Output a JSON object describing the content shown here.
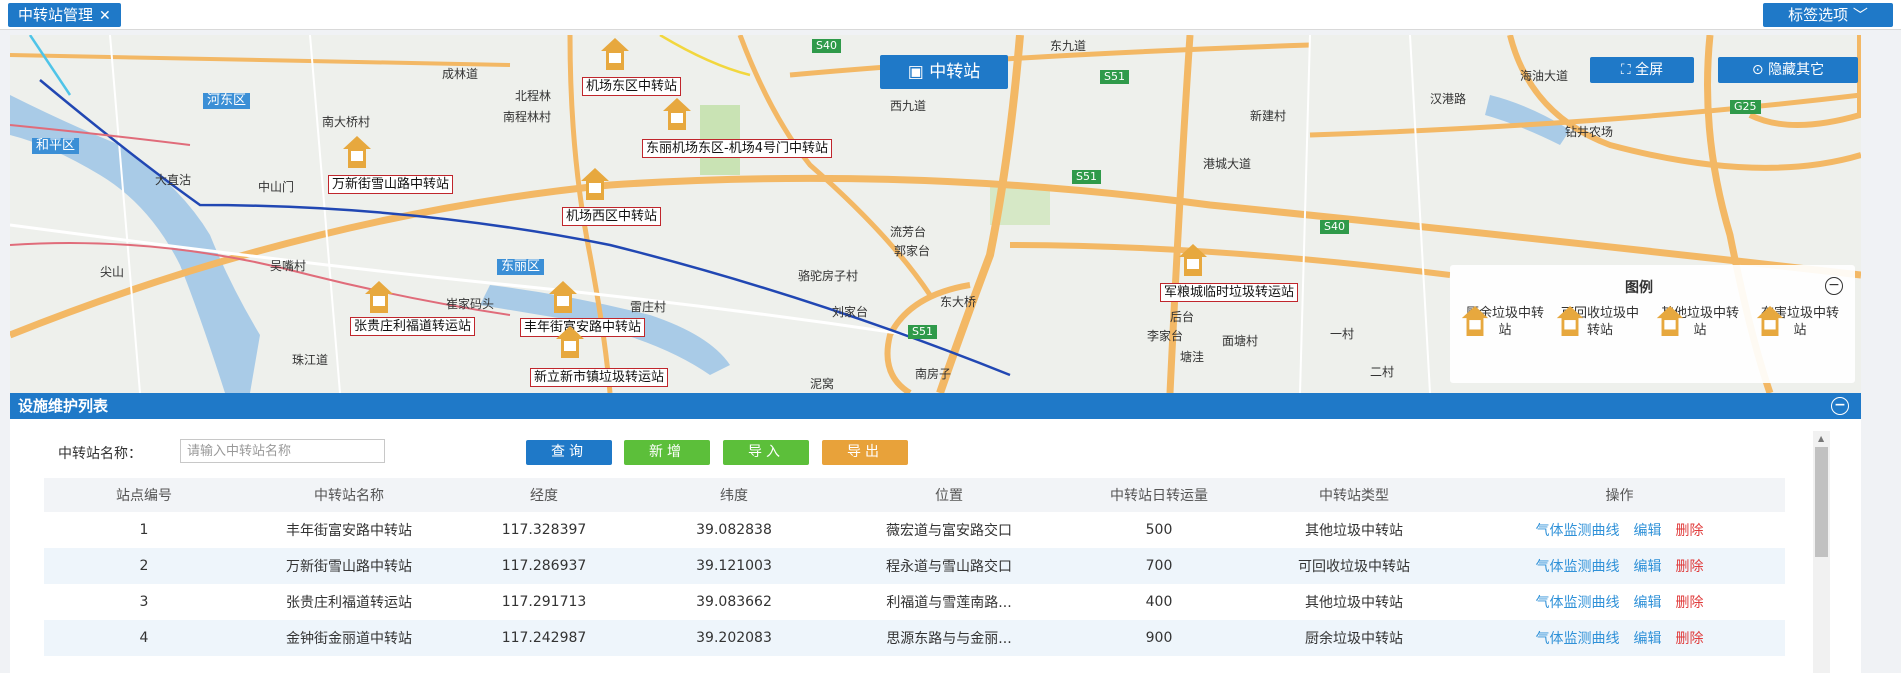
{
  "topbar": {
    "tab_label": "中转站管理",
    "tab_close": "✕",
    "tag_options": "标签选项",
    "tag_options_arrow": "﹀"
  },
  "map": {
    "title": "中转站",
    "fullscreen": "全屏",
    "hide_others": "隐藏其它",
    "districts": [
      "河东区",
      "和平区",
      "东丽区"
    ],
    "road_tags": [
      "S40",
      "S51",
      "S51",
      "S40",
      "S51",
      "G25"
    ],
    "place_labels": [
      "成林道",
      "北程林",
      "南程林村",
      "南大桥村",
      "大直沽",
      "中山门",
      "新建村",
      "港城大道",
      "钻井农场",
      "汉港路",
      "流芳台",
      "郭家台",
      "骆驼房子村",
      "吴嘴村",
      "东大桥",
      "刘家台",
      "后台",
      "李家台",
      "塘洼",
      "面塘村",
      "一村",
      "二村",
      "泥窝",
      "南房子",
      "尖山",
      "海油大道",
      "东九道",
      "西九道",
      "雷庄村",
      "崔家码头",
      "珠江道"
    ],
    "stations": [
      {
        "name": "机场东区中转站"
      },
      {
        "name": "东丽机场东区-机场4号门中转站"
      },
      {
        "name": "万新街雪山路中转站"
      },
      {
        "name": "机场西区中转站"
      },
      {
        "name": "军粮城临时垃圾转运站"
      },
      {
        "name": "张贵庄利福道转运站"
      },
      {
        "name": "丰年街富安路中转站"
      },
      {
        "name": "新立新市镇垃圾转运站"
      }
    ],
    "legend": {
      "title": "图例",
      "toggle": "−",
      "items": [
        "厨余垃圾中转站",
        "可回收垃圾中转站",
        "其他垃圾中转站",
        "有害垃圾中转站"
      ]
    }
  },
  "panel": {
    "title": "设施维护列表",
    "toggle": "−",
    "search_label": "中转站名称：",
    "search_placeholder": "请输入中转站名称",
    "buttons": {
      "query": "查询",
      "add": "新增",
      "import": "导入",
      "export": "导出"
    },
    "columns": [
      "站点编号",
      "中转站名称",
      "经度",
      "纬度",
      "位置",
      "中转站日转运量",
      "中转站类型",
      "操作"
    ],
    "row_actions": {
      "curve": "气体监测曲线",
      "edit": "编辑",
      "delete": "删除"
    },
    "rows": [
      {
        "id": "1",
        "name": "丰年街富安路中转站",
        "lng": "117.328397",
        "lat": "39.082838",
        "loc": "薇宏道与富安路交口",
        "vol": "500",
        "type": "其他垃圾中转站"
      },
      {
        "id": "2",
        "name": "万新街雪山路中转站",
        "lng": "117.286937",
        "lat": "39.121003",
        "loc": "程永道与雪山路交口",
        "vol": "700",
        "type": "可回收垃圾中转站"
      },
      {
        "id": "3",
        "name": "张贵庄利福道转运站",
        "lng": "117.291713",
        "lat": "39.083662",
        "loc": "利福道与雪莲南路...",
        "vol": "400",
        "type": "其他垃圾中转站"
      },
      {
        "id": "4",
        "name": "金钟街金丽道中转站",
        "lng": "117.242987",
        "lat": "39.202083",
        "loc": "思源东路与与金丽...",
        "vol": "900",
        "type": "厨余垃圾中转站"
      }
    ]
  },
  "colors": {
    "primary": "#1f79c8",
    "add": "#5cbf3a",
    "import": "#5cbf3a",
    "export": "#e8a23a",
    "link": "#2f91d8",
    "danger": "#e03c3c",
    "station_icon": "#e7a83e"
  }
}
